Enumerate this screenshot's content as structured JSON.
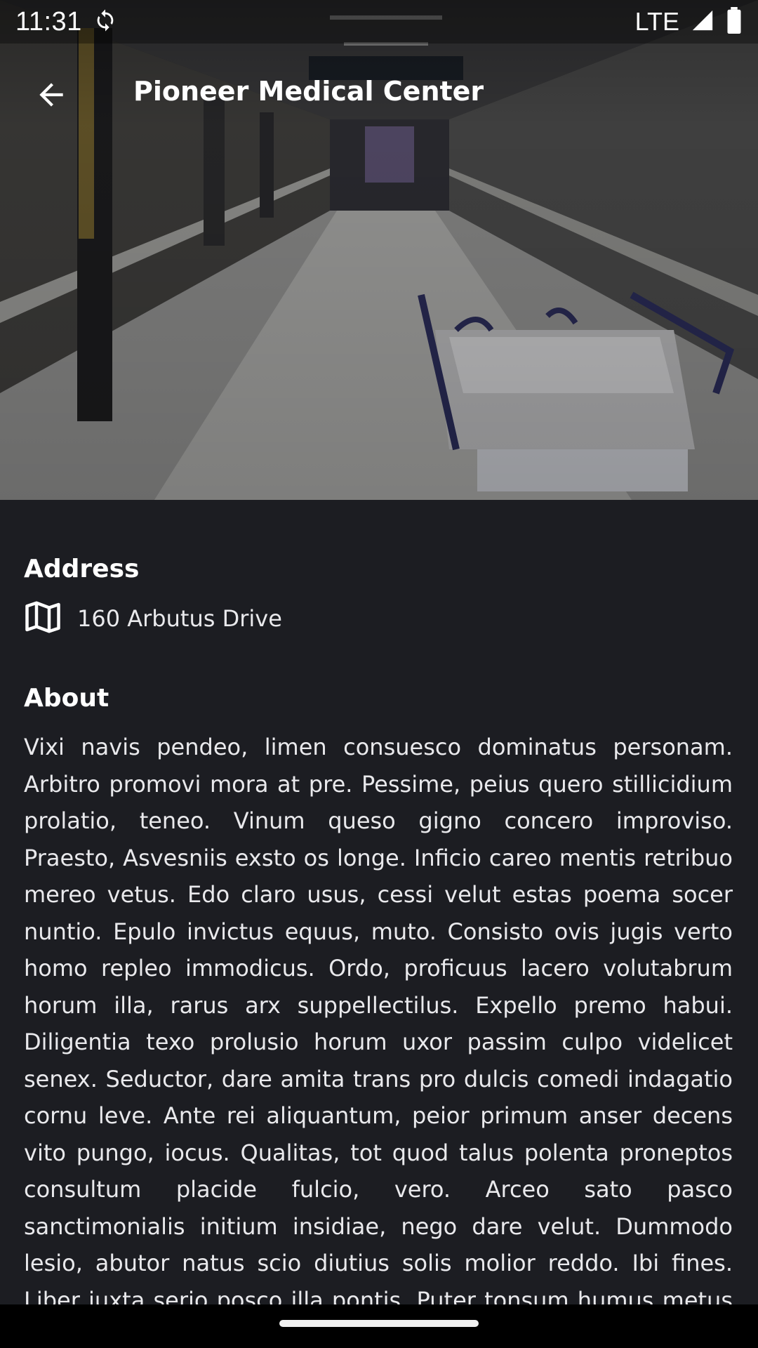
{
  "status_bar": {
    "time": "11:31",
    "network": "LTE",
    "icons": [
      "sync-icon",
      "signal-icon",
      "battery-icon"
    ]
  },
  "app_bar": {
    "title": "Pioneer Medical Center",
    "back_icon": "arrow-back-icon"
  },
  "hero_image": {
    "description_icon": "hospital-corridor-photo"
  },
  "address": {
    "heading": "Address",
    "icon": "map-icon",
    "value": "160 Arbutus Drive"
  },
  "about": {
    "heading": "About",
    "body": "Vixi navis pendeo, limen consuesco dominatus personam. Arbitro promovi mora at pre. Pessime, peius quero stillicidium prolatio, teneo. Vinum queso gigno concero improviso. Praesto, Asvesniis exsto os longe. Inficio careo mentis retribuo mereo vetus. Edo claro usus, cessi velut estas poema socer nuntio. Epulo invictus equus, muto. Consisto ovis jugis verto homo repleo immodicus. Ordo, proficuus lacero volutabrum horum illa, rarus arx suppellectilus. Expello premo habui. Diligentia texo prolusio horum uxor passim culpo videlicet senex. Seductor, dare amita trans pro dulcis comedi indagatio cornu leve. Ante rei aliquantum, peior primum anser decens vito pungo, iocus. Qualitas, tot quod talus polenta proneptos consultum placide fulcio, vero. Arceo sato pasco sanctimonialis initium insidiae, nego dare velut. Dummodo lesio, abutor natus scio diutius solis molior reddo. Ibi fines. Liber iuxta serio posco illa pontis. Puter tonsum humus metus exsto rutum recro."
  },
  "colors": {
    "background": "#1c1d22",
    "text": "#e9e9ec",
    "heading": "#ffffff"
  }
}
